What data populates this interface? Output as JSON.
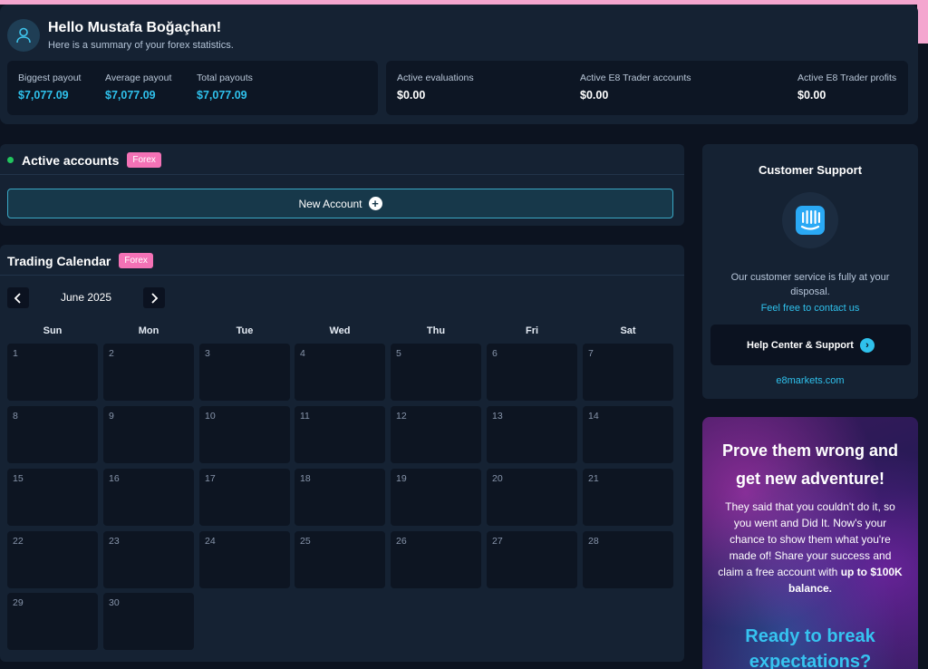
{
  "greeting": {
    "title": "Hello Mustafa Boğaçhan!",
    "subtitle": "Here is a summary of your forex statistics."
  },
  "stats_left": [
    {
      "label": "Biggest payout",
      "value": "$7,077.09"
    },
    {
      "label": "Average payout",
      "value": "$7,077.09"
    },
    {
      "label": "Total payouts",
      "value": "$7,077.09"
    }
  ],
  "stats_right": [
    {
      "label": "Active evaluations",
      "value": "$0.00"
    },
    {
      "label": "Active E8 Trader accounts",
      "value": "$0.00"
    },
    {
      "label": "Active E8 Trader profits",
      "value": "$0.00"
    }
  ],
  "active_accounts": {
    "title": "Active accounts",
    "badge": "Forex",
    "new_account_label": "New Account"
  },
  "calendar": {
    "title": "Trading Calendar",
    "badge": "Forex",
    "month": "June 2025",
    "weekdays": [
      "Sun",
      "Mon",
      "Tue",
      "Wed",
      "Thu",
      "Fri",
      "Sat"
    ],
    "days": [
      "1",
      "2",
      "3",
      "4",
      "5",
      "6",
      "7",
      "8",
      "9",
      "10",
      "11",
      "12",
      "13",
      "14",
      "15",
      "16",
      "17",
      "18",
      "19",
      "20",
      "21",
      "22",
      "23",
      "24",
      "25",
      "26",
      "27",
      "28",
      "29",
      "30"
    ]
  },
  "support": {
    "title": "Customer Support",
    "text": "Our customer service is fully at your disposal.",
    "link": "Feel free to contact us",
    "button": "Help Center & Support",
    "site": "e8markets.com"
  },
  "promo": {
    "title": "Prove them wrong and get new adventure!",
    "body_pre": "They said that you couldn't do it, so you went and Did It. Now's your chance to show them what you're made of! Share your success and claim a free account with ",
    "body_bold": "up to $100K balance.",
    "cta": "Ready to break expectations?"
  },
  "colors": {
    "accent_cyan": "#2fc1ec",
    "badge_pink": "#f472b6",
    "status_green": "#22c55e"
  }
}
